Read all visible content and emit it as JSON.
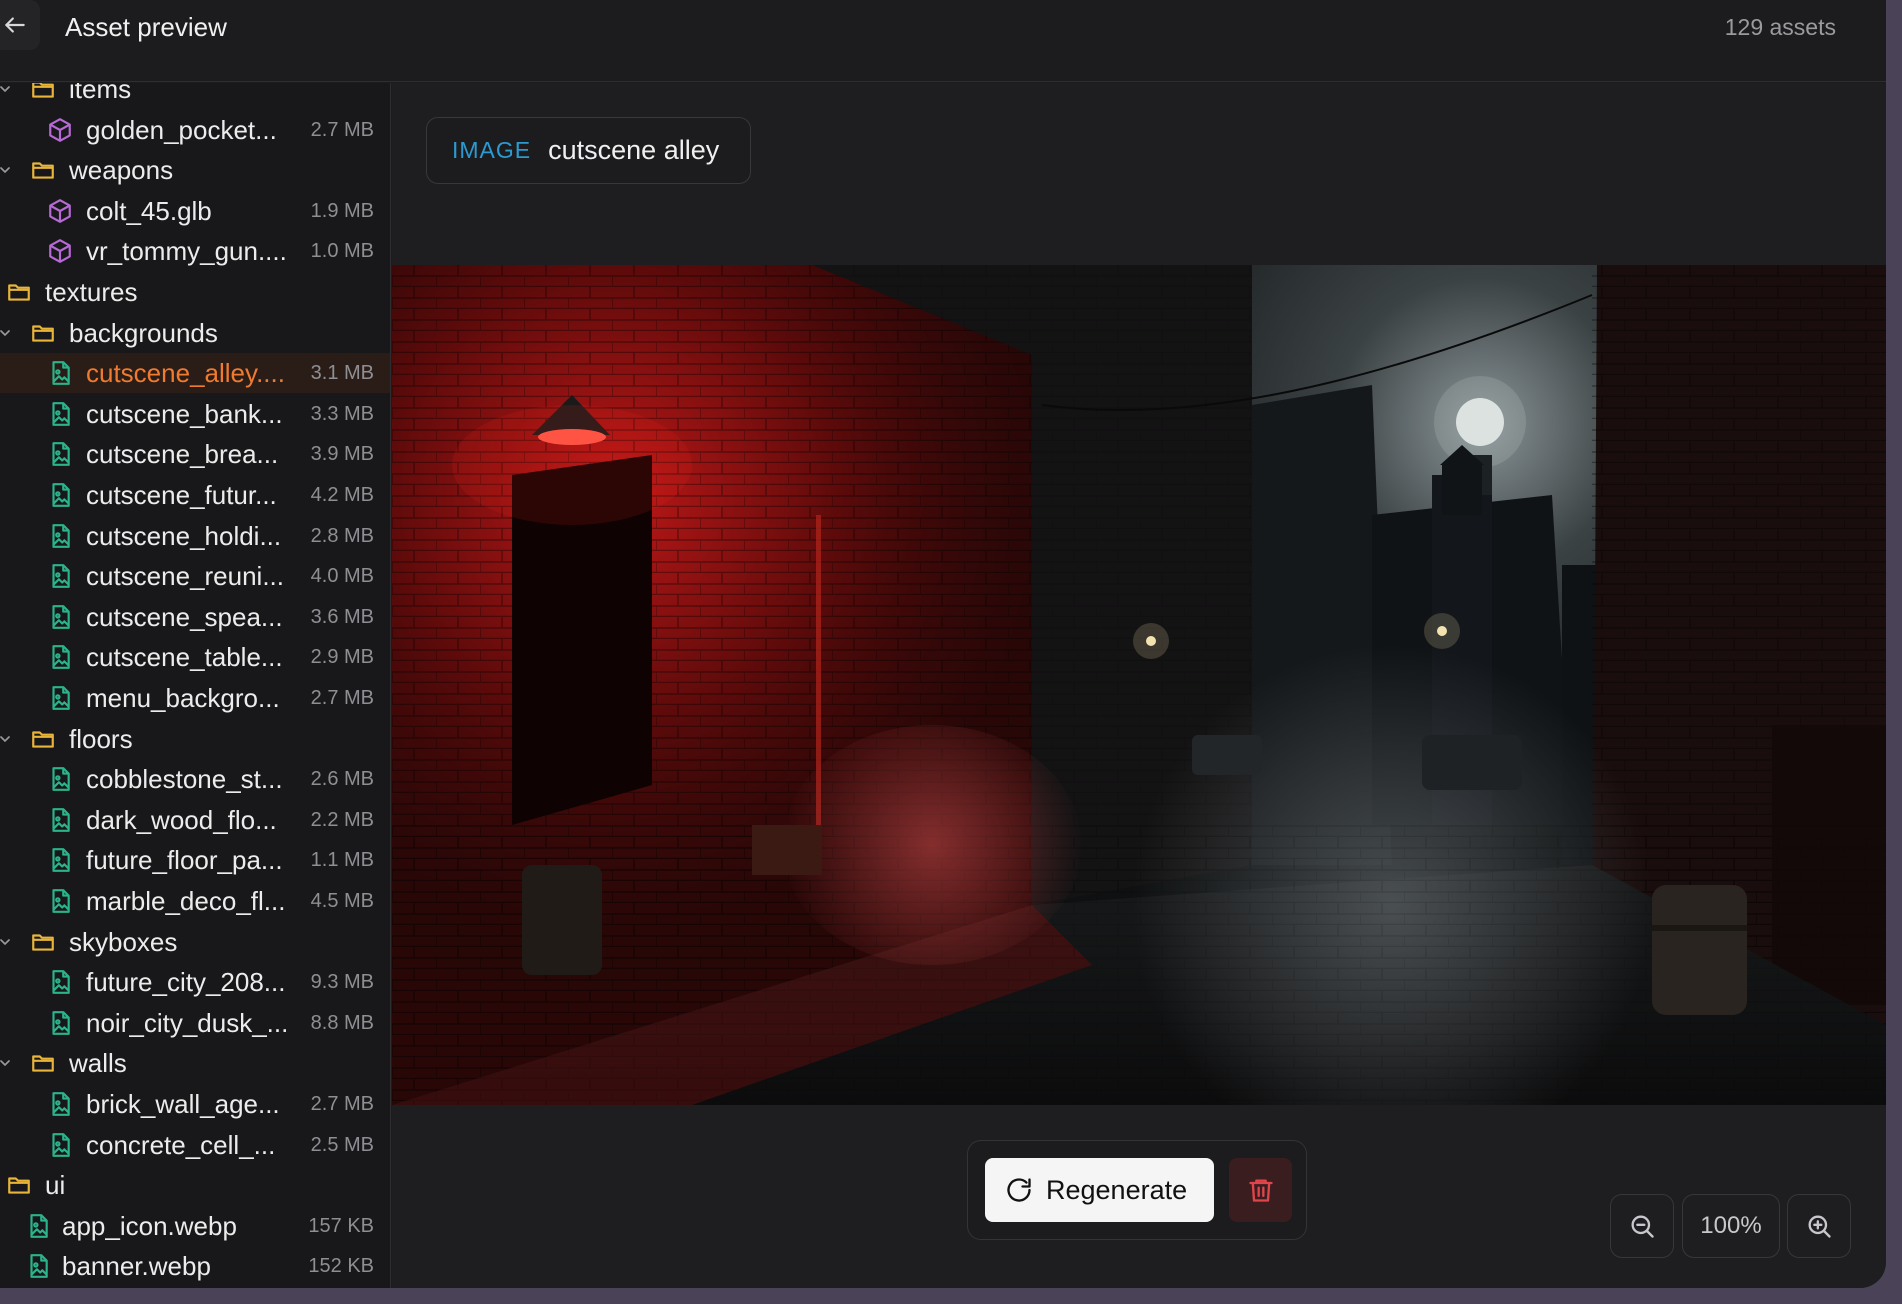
{
  "header": {
    "title": "Asset preview",
    "asset_count": "129 assets"
  },
  "tree": [
    {
      "type": "folder",
      "depth": 1,
      "expanded": true,
      "label": "items"
    },
    {
      "type": "model",
      "depth": 2,
      "label": "golden_pocket...",
      "size": "2.7 MB"
    },
    {
      "type": "folder",
      "depth": 1,
      "expanded": true,
      "label": "weapons"
    },
    {
      "type": "model",
      "depth": 2,
      "label": "colt_45.glb",
      "size": "1.9 MB"
    },
    {
      "type": "model",
      "depth": 2,
      "label": "vr_tommy_gun....",
      "size": "1.0 MB"
    },
    {
      "type": "folder",
      "depth": 0,
      "expanded": false,
      "label": "textures"
    },
    {
      "type": "folder",
      "depth": 1,
      "expanded": true,
      "label": "backgrounds"
    },
    {
      "type": "image",
      "depth": 2,
      "label": "cutscene_alley....",
      "size": "3.1 MB",
      "selected": true
    },
    {
      "type": "image",
      "depth": 2,
      "label": "cutscene_bank...",
      "size": "3.3 MB"
    },
    {
      "type": "image",
      "depth": 2,
      "label": "cutscene_brea...",
      "size": "3.9 MB"
    },
    {
      "type": "image",
      "depth": 2,
      "label": "cutscene_futur...",
      "size": "4.2 MB"
    },
    {
      "type": "image",
      "depth": 2,
      "label": "cutscene_holdi...",
      "size": "2.8 MB"
    },
    {
      "type": "image",
      "depth": 2,
      "label": "cutscene_reuni...",
      "size": "4.0 MB"
    },
    {
      "type": "image",
      "depth": 2,
      "label": "cutscene_spea...",
      "size": "3.6 MB"
    },
    {
      "type": "image",
      "depth": 2,
      "label": "cutscene_table...",
      "size": "2.9 MB"
    },
    {
      "type": "image",
      "depth": 2,
      "label": "menu_backgro...",
      "size": "2.7 MB"
    },
    {
      "type": "folder",
      "depth": 1,
      "expanded": true,
      "label": "floors"
    },
    {
      "type": "image",
      "depth": 2,
      "label": "cobblestone_st...",
      "size": "2.6 MB"
    },
    {
      "type": "image",
      "depth": 2,
      "label": "dark_wood_flo...",
      "size": "2.2 MB"
    },
    {
      "type": "image",
      "depth": 2,
      "label": "future_floor_pa...",
      "size": "1.1 MB"
    },
    {
      "type": "image",
      "depth": 2,
      "label": "marble_deco_fl...",
      "size": "4.5 MB"
    },
    {
      "type": "folder",
      "depth": 1,
      "expanded": true,
      "label": "skyboxes"
    },
    {
      "type": "image",
      "depth": 2,
      "label": "future_city_208...",
      "size": "9.3 MB"
    },
    {
      "type": "image",
      "depth": 2,
      "label": "noir_city_dusk_...",
      "size": "8.8 MB"
    },
    {
      "type": "folder",
      "depth": 1,
      "expanded": true,
      "label": "walls"
    },
    {
      "type": "image",
      "depth": 2,
      "label": "brick_wall_age...",
      "size": "2.7 MB"
    },
    {
      "type": "image",
      "depth": 2,
      "label": "concrete_cell_...",
      "size": "2.5 MB"
    },
    {
      "type": "folder",
      "depth": 0,
      "expanded": false,
      "label": "ui"
    },
    {
      "type": "image",
      "depth": 1,
      "label": "app_icon.webp",
      "size": "157 KB"
    },
    {
      "type": "image",
      "depth": 1,
      "label": "banner.webp",
      "size": "152 KB"
    }
  ],
  "asset": {
    "type_label": "IMAGE",
    "name": "cutscene alley"
  },
  "actions": {
    "regenerate_label": "Regenerate"
  },
  "zoom": {
    "level": "100%"
  },
  "colors": {
    "folder_icon": "#e8b53a",
    "model_icon": "#b76ad6",
    "image_icon": "#2bb38a",
    "selected_text": "#f07a2e",
    "tag_type": "#2b9ad1",
    "delete_icon": "#e0454b"
  },
  "icons": {
    "back": "arrow-left-icon",
    "folder": "folder-icon",
    "model": "cube-icon",
    "image": "image-file-icon",
    "regenerate": "refresh-icon",
    "delete": "trash-icon",
    "zoom_out": "zoom-out-icon",
    "zoom_in": "zoom-in-icon"
  }
}
